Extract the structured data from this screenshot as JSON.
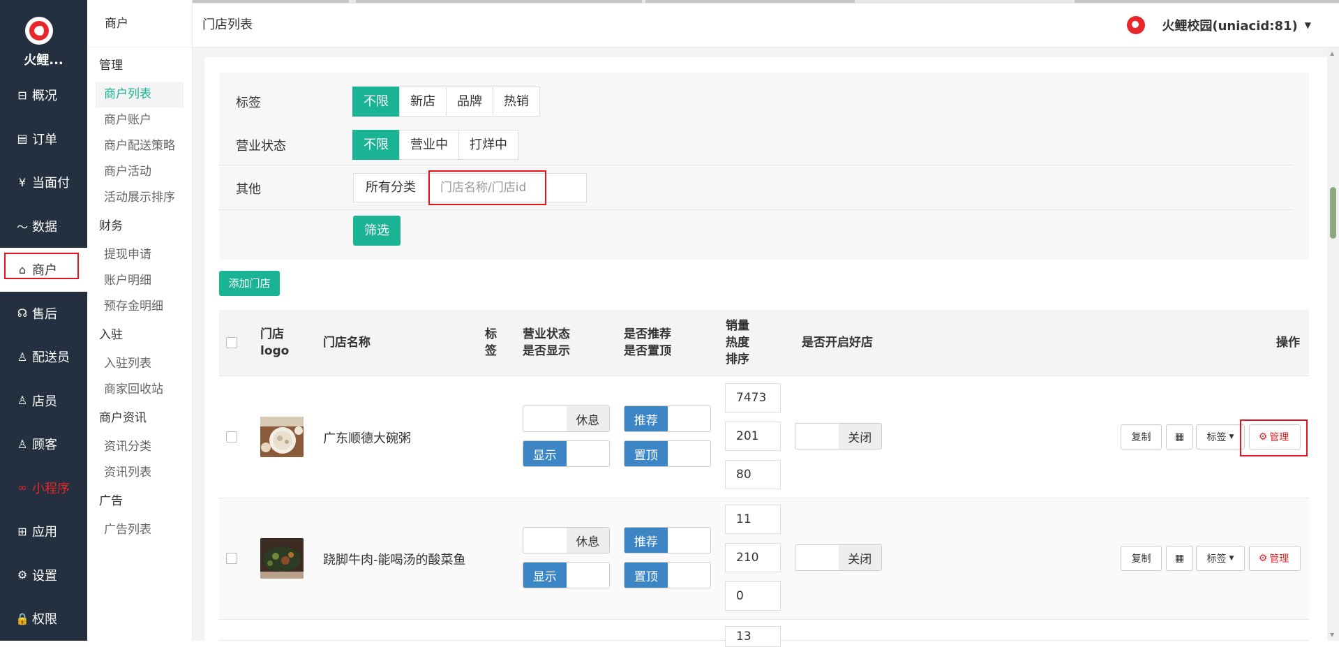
{
  "sidebar": {
    "brand": "火鲤...",
    "items": [
      {
        "label": "概况",
        "icon": "dashboard-icon",
        "glyph": "⊟"
      },
      {
        "label": "订单",
        "icon": "order-icon",
        "glyph": "▤"
      },
      {
        "label": "当面付",
        "icon": "yen-icon",
        "glyph": "¥"
      },
      {
        "label": "数据",
        "icon": "chart-icon",
        "glyph": "〜"
      },
      {
        "label": "商户",
        "icon": "store-icon",
        "glyph": "⌂"
      },
      {
        "label": "售后",
        "icon": "headset-icon",
        "glyph": "☊"
      },
      {
        "label": "配送员",
        "icon": "person-icon",
        "glyph": "♙"
      },
      {
        "label": "店员",
        "icon": "staff-icon",
        "glyph": "♙"
      },
      {
        "label": "顾客",
        "icon": "customer-icon",
        "glyph": "♙"
      },
      {
        "label": "小程序",
        "icon": "miniprogram-icon",
        "glyph": "∞"
      },
      {
        "label": "应用",
        "icon": "apps-icon",
        "glyph": "⊞"
      },
      {
        "label": "设置",
        "icon": "gear-icon",
        "glyph": "⚙"
      },
      {
        "label": "权限",
        "icon": "lock-icon",
        "glyph": "🔒"
      }
    ]
  },
  "subnav": {
    "title": "商户",
    "groups": [
      {
        "label": "管理",
        "items": [
          "商户列表",
          "商户账户",
          "商户配送策略",
          "商户活动",
          "活动展示排序"
        ]
      },
      {
        "label": "财务",
        "items": [
          "提现申请",
          "账户明细",
          "预存金明细"
        ]
      },
      {
        "label": "入驻",
        "items": [
          "入驻列表",
          "商家回收站"
        ]
      },
      {
        "label": "商户资讯",
        "items": [
          "资讯分类",
          "资讯列表"
        ]
      },
      {
        "label": "广告",
        "items": [
          "广告列表"
        ]
      }
    ]
  },
  "header": {
    "page_title": "门店列表",
    "user": "火鲤校园(uniacid:81)"
  },
  "filter": {
    "tag_label": "标签",
    "tag_options": [
      "不限",
      "新店",
      "品牌",
      "热销"
    ],
    "status_label": "营业状态",
    "status_options": [
      "不限",
      "营业中",
      "打烊中"
    ],
    "other_label": "其他",
    "category": "所有分类",
    "search_placeholder": "门店名称/门店id",
    "submit": "筛选"
  },
  "add_button": "添加门店",
  "table": {
    "headers": {
      "logo": [
        "门店",
        "logo"
      ],
      "name": "门店名称",
      "tag": [
        "标",
        "签"
      ],
      "status": [
        "营业状态",
        "是否显示"
      ],
      "recommend": [
        "是否推荐",
        "是否置顶"
      ],
      "sales": [
        "销量",
        "热度",
        "排序"
      ],
      "goodstore": "是否开启好店",
      "ops": "操作"
    },
    "rows": [
      {
        "name": "广东顺德大碗粥",
        "status": "休息",
        "display": "显示",
        "recommend": "推荐",
        "top": "置顶",
        "sales": "7473",
        "heat": "201",
        "sort": "80",
        "goodstore": "关闭"
      },
      {
        "name": "跷脚牛肉-能喝汤的酸菜鱼",
        "status": "休息",
        "display": "显示",
        "recommend": "推荐",
        "top": "置顶",
        "sales": "11",
        "heat": "210",
        "sort": "0",
        "goodstore": "关闭"
      },
      {
        "name": "",
        "sales": "13"
      }
    ],
    "ops": {
      "copy": "复制",
      "qr_icon": "qrcode-icon",
      "tag": "标签",
      "manage": "管理"
    }
  }
}
